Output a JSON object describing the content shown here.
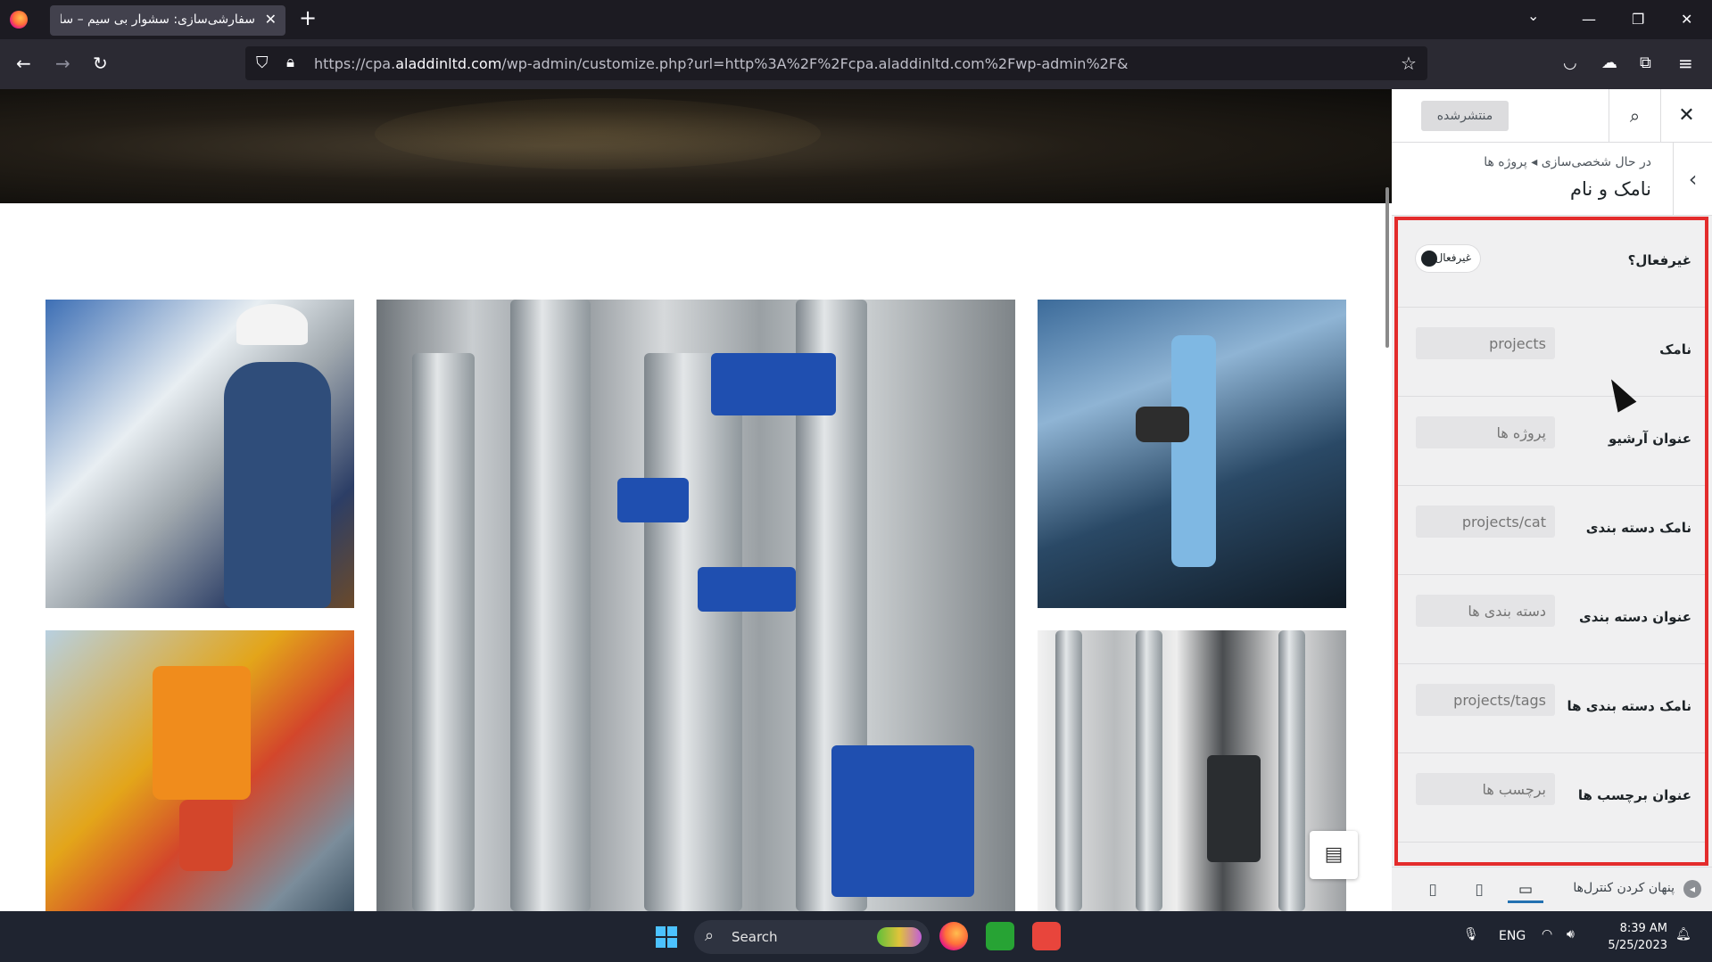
{
  "browser": {
    "tab_title": "سفارشی‌سازی: سشوار بی سیم – سایت",
    "tab_close": "✕",
    "new_tab": "+",
    "url_prefix": "https://cpa.",
    "url_domain": "aladdinltd.com",
    "url_rest": "/wp-admin/customize.php?url=http%3A%2F%2Fcpa.aladdinltd.com%2Fwp-admin%2F&",
    "icons": [
      "back-icon",
      "forward-icon",
      "reload-icon",
      "shield-icon",
      "lock-icon",
      "star-icon",
      "pocket-icon",
      "extension-icon",
      "puzzle-icon",
      "menu-icon"
    ]
  },
  "customizer": {
    "publish_label": "منتشرشده",
    "close_label": "✕",
    "search_label": "⌕",
    "breadcrumb": "در حال شخصی‌سازی ◂ پروژه ها",
    "section_title": "نامک و نام",
    "fields": [
      {
        "label": "غیرفعال؟",
        "toggle_text": "غیرفعال"
      },
      {
        "label": "نامک",
        "placeholder": "projects"
      },
      {
        "label": "عنوان آرشیو",
        "placeholder": "پروژه ها"
      },
      {
        "label": "نامک دسته بندی",
        "placeholder": "projects/cat"
      },
      {
        "label": "عنوان دسته بندی",
        "placeholder": "دسته بندی ها"
      },
      {
        "label": "نامک دسته بندی ها",
        "placeholder": "projects/tags"
      },
      {
        "label": "عنوان برچسب ها",
        "placeholder": "برچسب ها"
      }
    ],
    "footer": {
      "hide_controls": "پنهان کردن کنترل‌ها",
      "devices": [
        "mobile-icon",
        "tablet-icon",
        "desktop-icon"
      ]
    }
  },
  "taskbar": {
    "search_label": "Search",
    "language": "ENG",
    "time": "8:39 AM",
    "date": "5/25/2023"
  },
  "colors": {
    "highlight": "#e32c2c",
    "accent": "#2271b1"
  }
}
